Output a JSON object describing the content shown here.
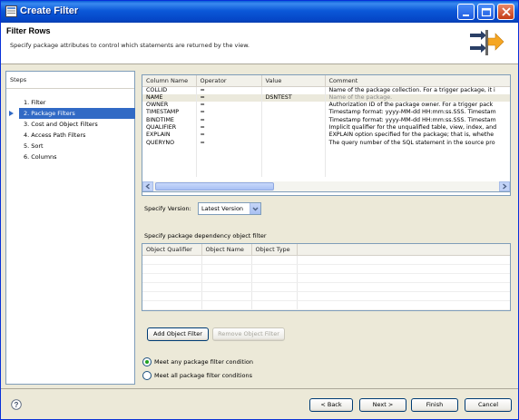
{
  "window": {
    "title": "Create Filter"
  },
  "header": {
    "title": "Filter Rows",
    "description": "Specify package attributes to control which statements are returned by the view."
  },
  "steps": {
    "heading": "Steps",
    "items": [
      {
        "label": "1. Filter"
      },
      {
        "label": "2. Package Filters"
      },
      {
        "label": "3. Cost and Object Filters"
      },
      {
        "label": "4. Access Path Filters"
      },
      {
        "label": "5. Sort"
      },
      {
        "label": "6. Columns"
      }
    ],
    "active_index": 1
  },
  "filter_table": {
    "columns": [
      "Column Name",
      "Operator",
      "Value",
      "Comment"
    ],
    "rows": [
      [
        "COLLID",
        "=",
        "",
        "Name of the package collection. For a trigger package, it i"
      ],
      [
        "NAME",
        "=",
        "DSNTEST",
        "Name of the package."
      ],
      [
        "OWNER",
        "=",
        "",
        "Authorization ID of the package owner. For a trigger pack"
      ],
      [
        "TIMESTAMP",
        "=",
        "",
        "Timestamp format: yyyy-MM-dd HH:mm:ss.SSS. Timestam"
      ],
      [
        "BINDTIME",
        "=",
        "",
        "Timestamp format: yyyy-MM-dd HH:mm:ss.SSS. Timestam"
      ],
      [
        "QUALIFIER",
        "=",
        "",
        "Implicit qualifier for the unqualified table, view, index, and"
      ],
      [
        "EXPLAIN",
        "=",
        "",
        "EXPLAIN option specified for the package; that is, whethe"
      ],
      [
        "QUERYNO",
        "=",
        "",
        "The query number of the SQL statement in the source pro"
      ]
    ],
    "selected_row": 1
  },
  "version": {
    "label": "Specify Version:",
    "selected": "Latest Version"
  },
  "dependency": {
    "label": "Specify package dependency object filter",
    "columns": [
      "Object Qualifier",
      "Object Name",
      "Object Type"
    ],
    "add_button": "Add Object Filter",
    "remove_button": "Remove Object Filter"
  },
  "conditions": {
    "any_label": "Meet any package filter condition",
    "all_label": "Meet all package filter conditions",
    "selected": "any"
  },
  "footer": {
    "back": "< Back",
    "next": "Next >",
    "finish": "Finish",
    "cancel": "Cancel"
  }
}
